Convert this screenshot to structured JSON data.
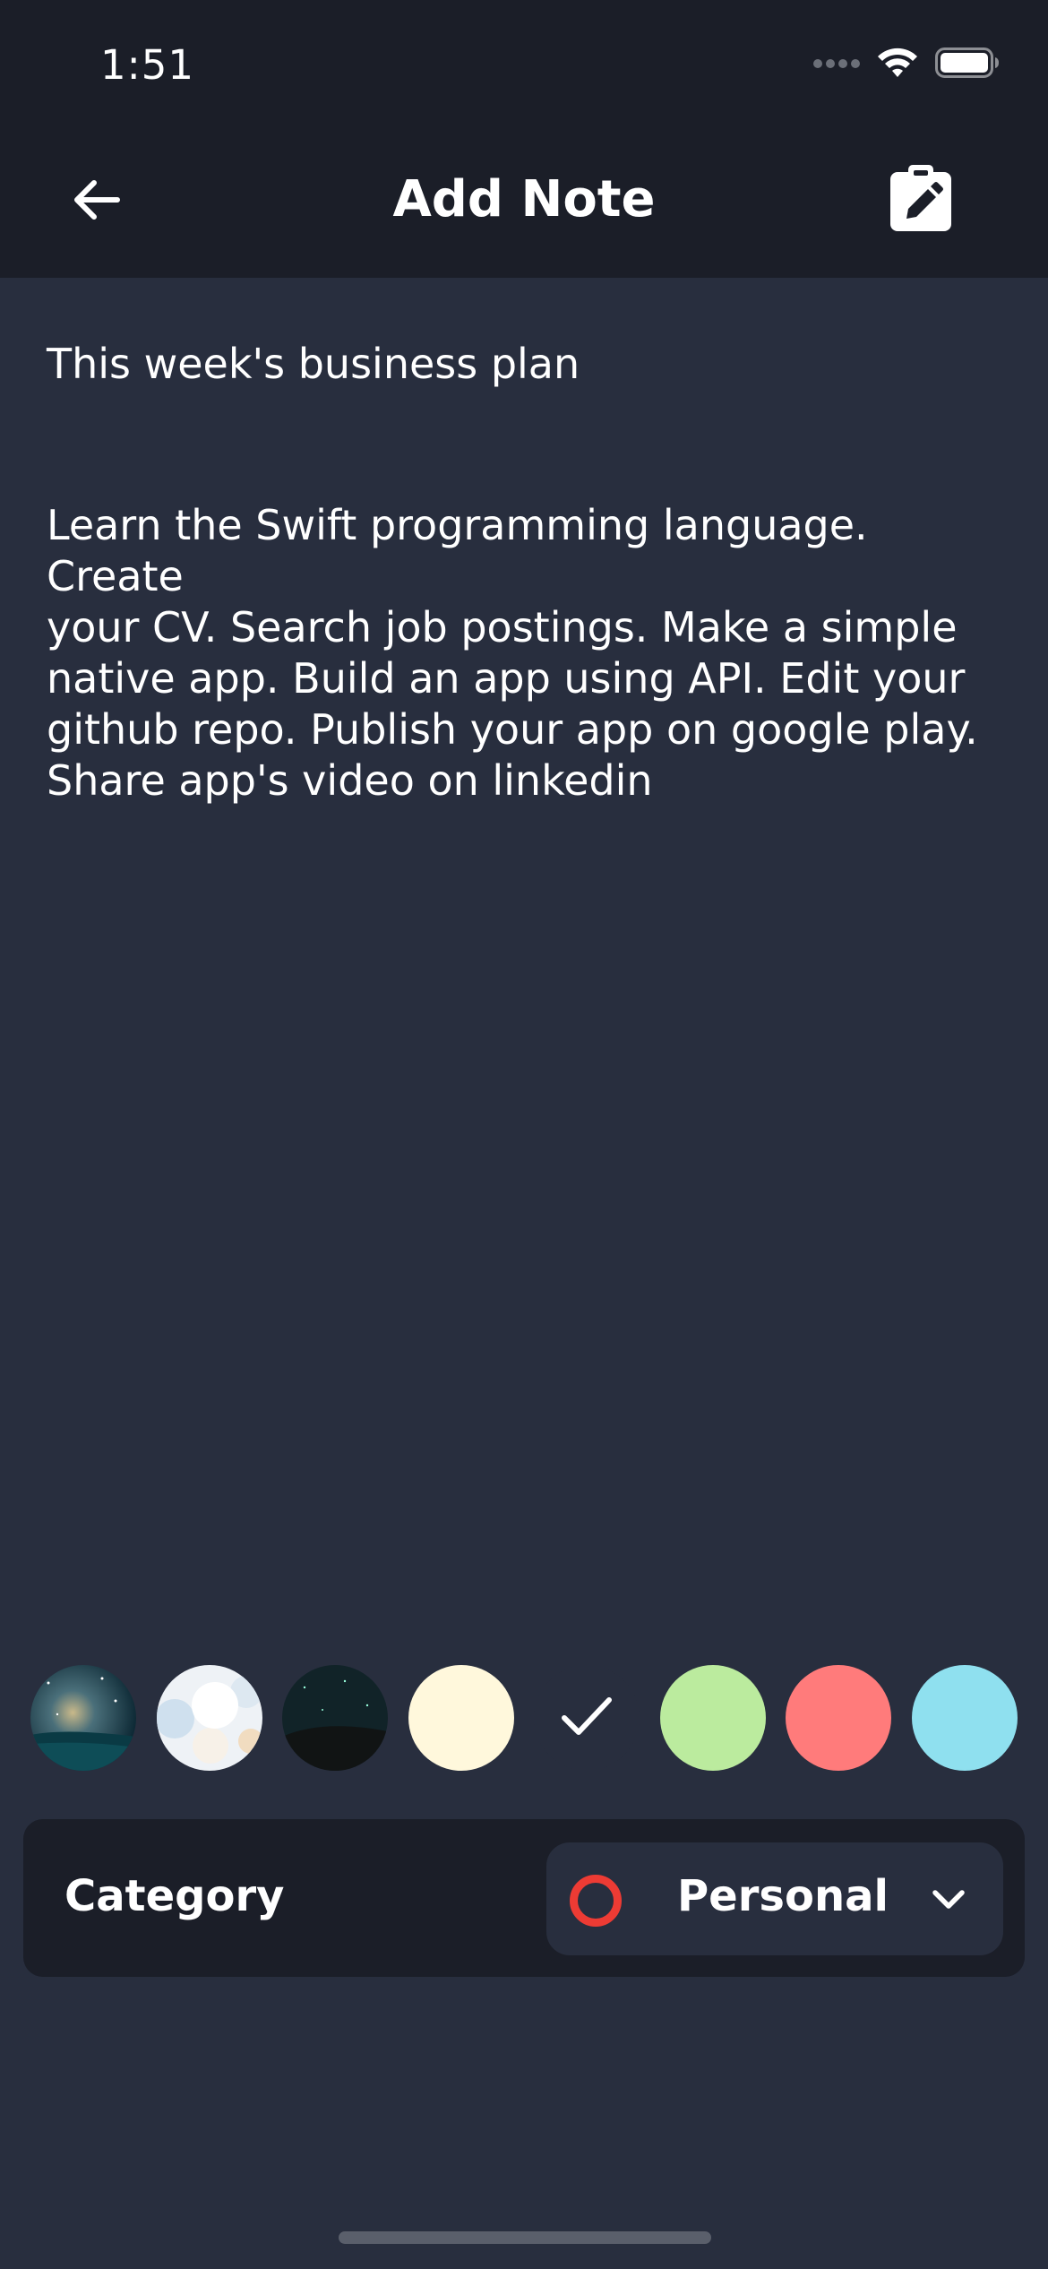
{
  "status_bar": {
    "time": "1:51"
  },
  "header": {
    "title": "Add Note",
    "back_icon": "arrow-left-icon",
    "save_icon": "clipboard-edit-icon"
  },
  "note": {
    "title": "This week's business plan",
    "body": "Learn the Swift programming language. Create\nyour CV. Search job postings. Make a simple\nnative app. Build an app using API. Edit your\ngithub repo. Publish your app on google play.\nShare app's video on linkedin"
  },
  "background_options": [
    {
      "kind": "image",
      "name": "milky-way"
    },
    {
      "kind": "image",
      "name": "white-clouds"
    },
    {
      "kind": "image",
      "name": "night-hills"
    },
    {
      "kind": "color",
      "color": "#fff8dc"
    },
    {
      "kind": "color",
      "color": "#282e3e",
      "selected": true
    },
    {
      "kind": "color",
      "color": "#bbeb9e"
    },
    {
      "kind": "color",
      "color": "#ff7b7b"
    },
    {
      "kind": "color",
      "color": "#8fe0ef"
    }
  ],
  "category": {
    "label": "Category",
    "value": "Personal",
    "dot_color": "#ed3b34",
    "icon": "chevron-down-icon"
  },
  "colors": {
    "background": "#282e3e",
    "bar": "#1b1e28",
    "text": "#ffffff"
  }
}
